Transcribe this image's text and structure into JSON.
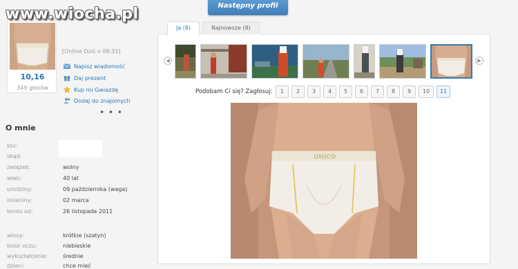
{
  "watermark": "www.wiocha.pl",
  "profile": {
    "rating": "10,16",
    "votes": "349 głosów",
    "online": "[Online Dziś o 08:33]",
    "actions": [
      "Napisz wiadomość",
      "Daj prezent",
      "Kup mi Gwiazdę",
      "Dodaj do znajomych"
    ],
    "more": "• • •"
  },
  "about": {
    "title": "O mnie",
    "rows": [
      {
        "key": "kto:",
        "value": ""
      },
      {
        "key": "skąd:",
        "value": ""
      },
      {
        "key": "związek:",
        "value": "wolny"
      },
      {
        "key": "wiek:",
        "value": "40 lat"
      },
      {
        "key": "urodziny:",
        "value": "09 października (waga)"
      },
      {
        "key": "imieniny:",
        "value": "02 marca"
      },
      {
        "key": "konto od:",
        "value": "26 listopada 2011"
      },
      {
        "key": "włosy:",
        "value": "krótkie (szatyn)"
      },
      {
        "key": "kolor oczu:",
        "value": "niebieskie"
      },
      {
        "key": "wykształcenie:",
        "value": "średnie"
      },
      {
        "key": "dzieci:",
        "value": "chce mieć"
      }
    ]
  },
  "next_profile": "Następny profil",
  "tabs": [
    {
      "label": "Ja (8)",
      "active": true
    },
    {
      "label": "Najnowsze (8)",
      "active": false
    }
  ],
  "vote": {
    "label": "Podobam Ci się? Zagłosuj:",
    "numbers": [
      "1",
      "2",
      "3",
      "4",
      "5",
      "6",
      "7",
      "8",
      "9",
      "10",
      "11"
    ]
  },
  "colors": {
    "accent": "#2b78b8",
    "selected_border": "#2e7bb5"
  }
}
